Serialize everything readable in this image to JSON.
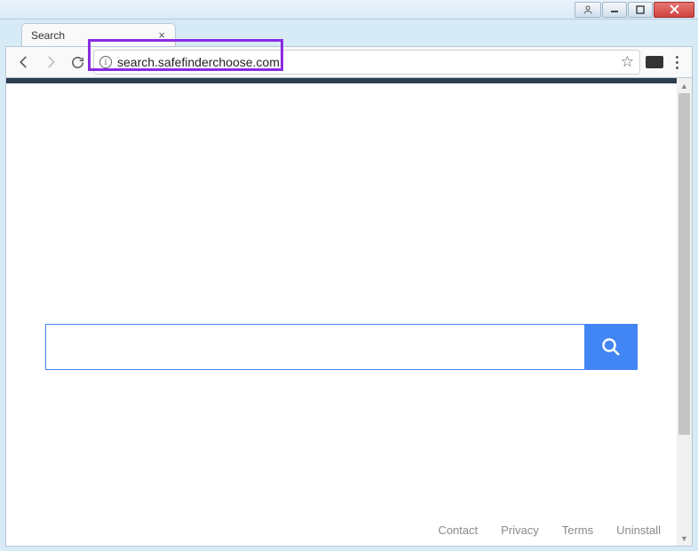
{
  "window": {
    "buttons": [
      "minimize",
      "maximize",
      "close"
    ]
  },
  "browser": {
    "tab": {
      "title": "Search"
    },
    "url": "search.safefinderchoose.com"
  },
  "page": {
    "search": {
      "value": "",
      "placeholder": ""
    },
    "footer": {
      "links": [
        "Contact",
        "Privacy",
        "Terms",
        "Uninstall"
      ]
    }
  },
  "colors": {
    "highlight": "#8a2be2",
    "accent": "#4285f4",
    "dark_bar": "#2c3e50"
  }
}
